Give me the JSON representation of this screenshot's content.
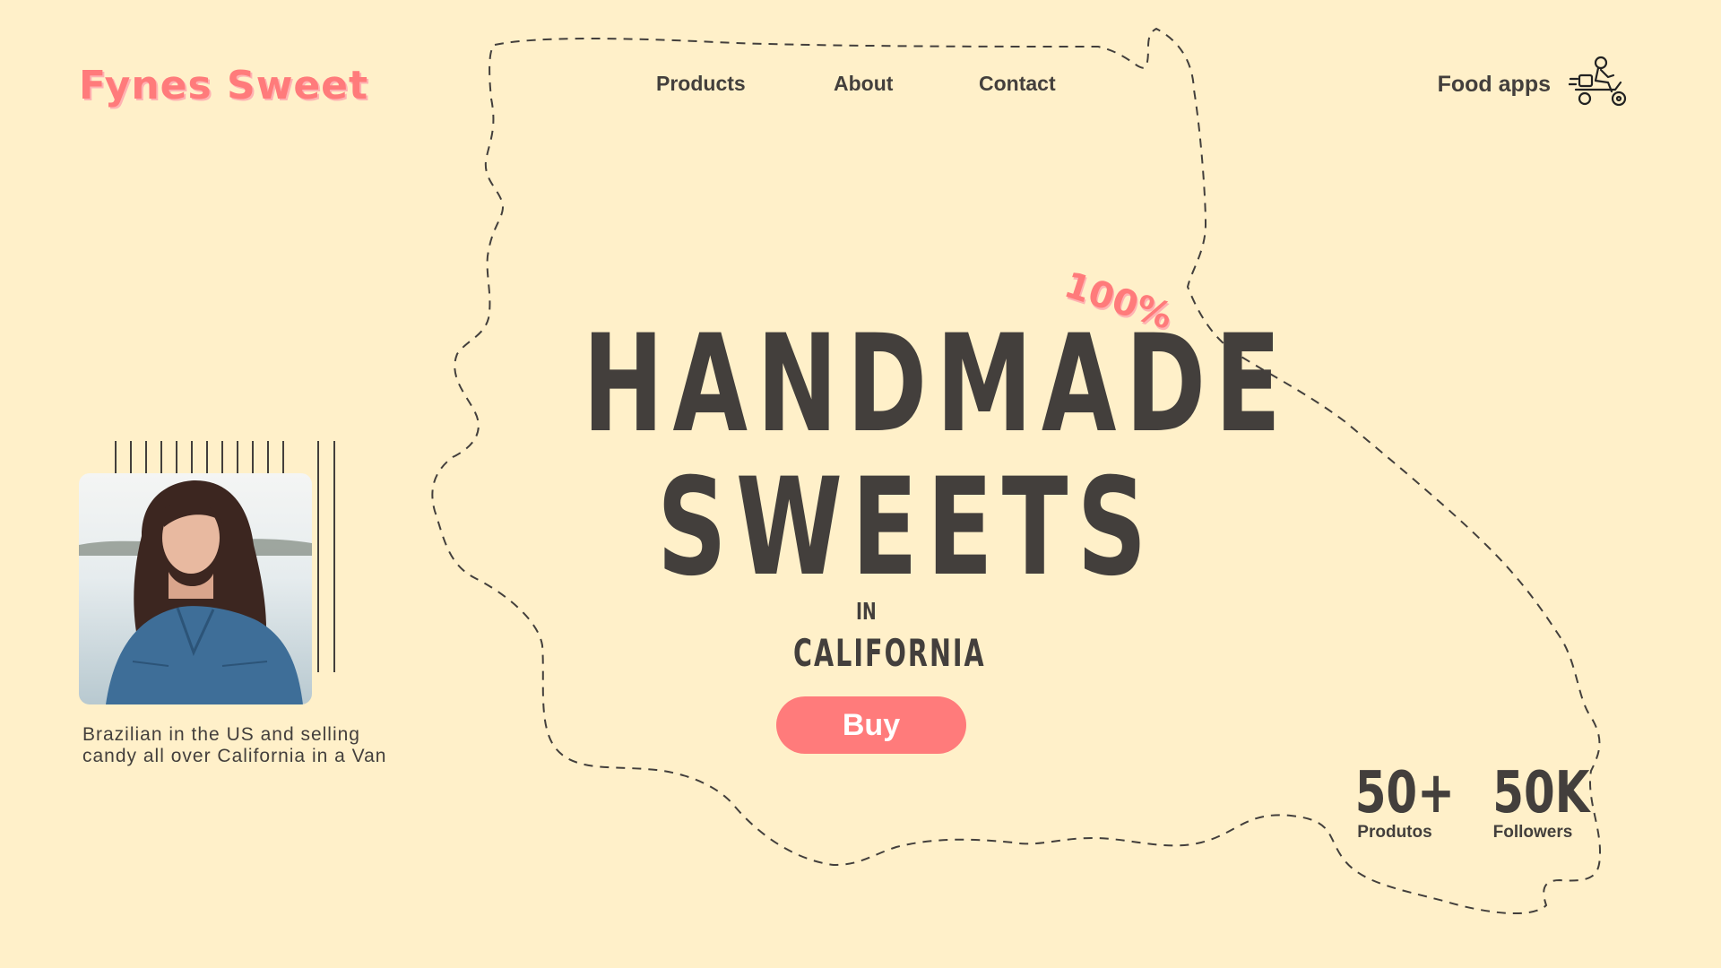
{
  "brand": {
    "name": "Fynes Sweet"
  },
  "nav": {
    "items": [
      {
        "label": "Products"
      },
      {
        "label": "About"
      },
      {
        "label": "Contact"
      }
    ]
  },
  "header_right": {
    "label": "Food apps",
    "icon": "delivery-scooter-icon"
  },
  "hero": {
    "badge": "100%",
    "line1": "HANDMADE",
    "line2": "SWEETS",
    "in_text": "IN",
    "location": "CALIFORNIA",
    "cta_label": "Buy"
  },
  "profile": {
    "caption_line1": "Brazilian in the US and selling",
    "caption_line2": "candy all over California in a Van"
  },
  "stats": [
    {
      "value": "50+",
      "label": "Produtos"
    },
    {
      "value": "50K",
      "label": "Followers"
    }
  ],
  "colors": {
    "background": "#FFF0C9",
    "accent": "#FF7B7B",
    "text": "#433F3C"
  }
}
